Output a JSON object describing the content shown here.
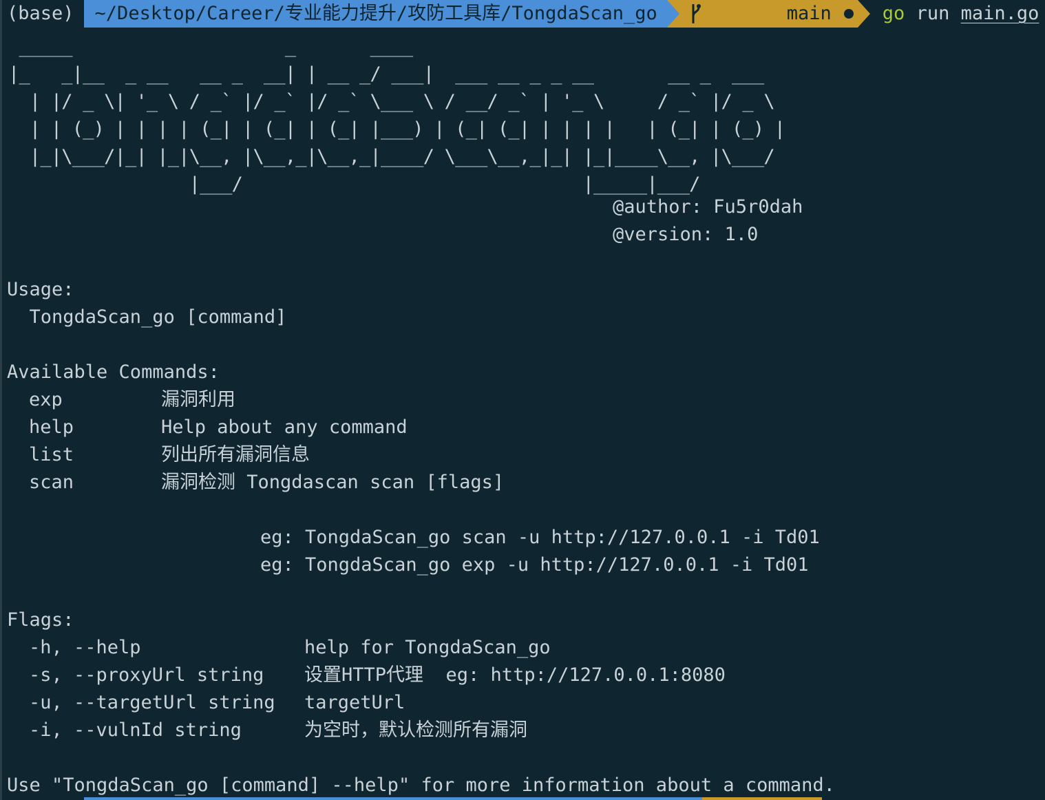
{
  "prompt": {
    "env": "(base)",
    "path": "~/Desktop/Career/专业能力提升/攻防工具库/TongdaScan_go",
    "branch": "main",
    "command": "go",
    "sub": "run",
    "arg": "main.go",
    "branch_icon": "git-branch-icon",
    "colors": {
      "path_bg": "#4a8fd8",
      "git_bg": "#c89a2c",
      "cmd": "#a7c93a",
      "bg": "#0f2530"
    }
  },
  "banner": {
    "ascii": " _____                    _       ____\n|_   _|__  _ __   __ _  __| | __ _/ ___|  ___ __ _ _ __       __ _  ___\n  | |/ _ \\| '_ \\ / _` |/ _` |/ _` \\___ \\ / __/ _` | '_ \\     / _` |/ _ \\\n  | | (_) | | | | (_| | (_| | (_| |___) | (_| (_| | | | |   | (_| | (_) |\n  |_|\\___/|_| |_|\\__, |\\__,_|\\__,_|____/ \\___\\__,_|_| |_|____\\__, |\\___/\n                 |___/                                |_____|___/",
    "author": "@author: Fu5r0dah",
    "version": "@version: 1.0"
  },
  "usage": {
    "header": "Usage:",
    "line": "  TongdaScan_go [command]"
  },
  "commands": {
    "header": "Available Commands:",
    "items": [
      {
        "name": "exp",
        "desc": "漏洞利用"
      },
      {
        "name": "help",
        "desc": "Help about any command"
      },
      {
        "name": "list",
        "desc": "列出所有漏洞信息"
      },
      {
        "name": "scan",
        "desc": "漏洞检测 Tongdascan scan [flags]"
      }
    ],
    "examples": [
      "eg: TongdaScan_go scan -u http://127.0.0.1 -i Td01",
      "eg: TongdaScan_go exp -u http://127.0.0.1 -i Td01"
    ]
  },
  "flags": {
    "header": "Flags:",
    "items": [
      {
        "flag": "-h, --help",
        "desc": "help for TongdaScan_go"
      },
      {
        "flag": "-s, --proxyUrl string",
        "desc": "设置HTTP代理  eg: http://127.0.0.1:8080"
      },
      {
        "flag": "-u, --targetUrl string",
        "desc": "targetUrl"
      },
      {
        "flag": "-i, --vulnId string",
        "desc": "为空时，默认检测所有漏洞"
      }
    ]
  },
  "footer": "Use \"TongdaScan_go [command] --help\" for more information about a command."
}
